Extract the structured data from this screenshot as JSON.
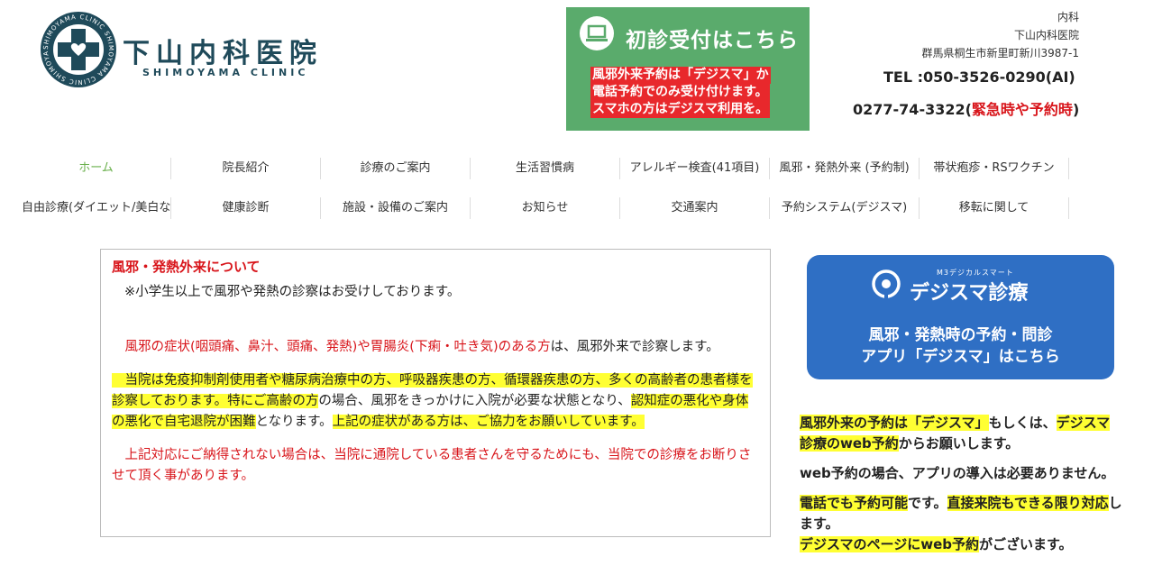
{
  "header": {
    "logo_ring_text": "SHIMOYAMA CLINIC SHIMOYAMA CLINIC SHIMOYAMA CLINIC",
    "clinic_name": "下山内科医院",
    "clinic_name_en": "SHIMOYAMA CLINIC"
  },
  "reception": {
    "title": "初診受付はこちら",
    "notes": [
      "風邪外来予約は「デジスマ」か",
      "電話予約でのみ受け付けます。",
      "スマホの方はデジスマ利用を。"
    ]
  },
  "contact": {
    "dept": "内科",
    "name": "下山内科医院",
    "address": "群馬県桐生市新里町新川3987-1",
    "tel1": "TEL :050-3526-0290(AI)",
    "tel2_number": "0277-74-3322(",
    "tel2_note": "緊急時や予約時",
    "tel2_close": ")"
  },
  "nav": {
    "row1": [
      "ホーム",
      "院長紹介",
      "診療のご案内",
      "生活習慣病",
      "アレルギー検査(41項目)",
      "風邪・発熱外来 (予約制)",
      "帯状疱疹・RSワクチン"
    ],
    "row2": [
      "自由診療(ダイエット/美白など)",
      "健康診断",
      "施設・設備のご案内",
      "お知らせ",
      "交通案内",
      "予約システム(デジスマ)",
      "移転に関して"
    ]
  },
  "notice": {
    "title": "風邪・発熱外来について",
    "intro": "※小学生以上で風邪や発熱の診察はお受けしております。",
    "symptom_red": "風邪の症状(咽頭痛、鼻汁、頭痛、発熱)や胃腸炎(下痢・吐き気)のある方",
    "symptom_rest": "は、風邪外来で診察します。",
    "risk_hl1": "当院は免疫抑制剤使用者や糖尿病治療中の方、呼吸器疾患の方、循環器疾患の方、多くの高齢者の患者様を診察しております。特にご高齢の方",
    "risk_mid": "の場合、風邪をきっかけに入院が必要な状態となり、",
    "risk_hl2": "認知症の悪化や身体の悪化で自宅退院が困難",
    "risk_mid2": "となります。",
    "risk_hl3": "上記の症状がある方は、ご協力をお願いしています。",
    "refuse": "上記対応にご納得されない場合は、当院に通院している患者さんを守るためにも、当院での診療をお断りさせて頂く事があります。"
  },
  "banner": {
    "sub": "M3デジカルスマート",
    "brand": "デジスマ診療",
    "line1": "風邪・発熱時の予約・問診",
    "line2": "アプリ「デジスマ」はこちら"
  },
  "side": {
    "p1_hl1": "風邪外来の予約は「デジスマ」",
    "p1_mid": "もしくは、",
    "p1_hl2": "デジスマ診療のweb予約",
    "p1_end": "からお願いします。",
    "p2": "web予約の場合、アプリの導入は必要ありません。",
    "p3_hl1": "電話でも予約可能",
    "p3_mid": "です。",
    "p3_hl2": "直接来院もできる限り対応",
    "p3_end": "します。",
    "p4_hl1": "デジスマのページにweb予約",
    "p4_end": "がございます。"
  },
  "colors": {
    "brand_dark": "#1f4a5a",
    "reception_green": "#5aab6c",
    "alert_red": "#d8141a",
    "highlight_yellow": "#ffff33",
    "banner_blue": "#2f6fc4",
    "nav_active": "#6ab04c"
  }
}
